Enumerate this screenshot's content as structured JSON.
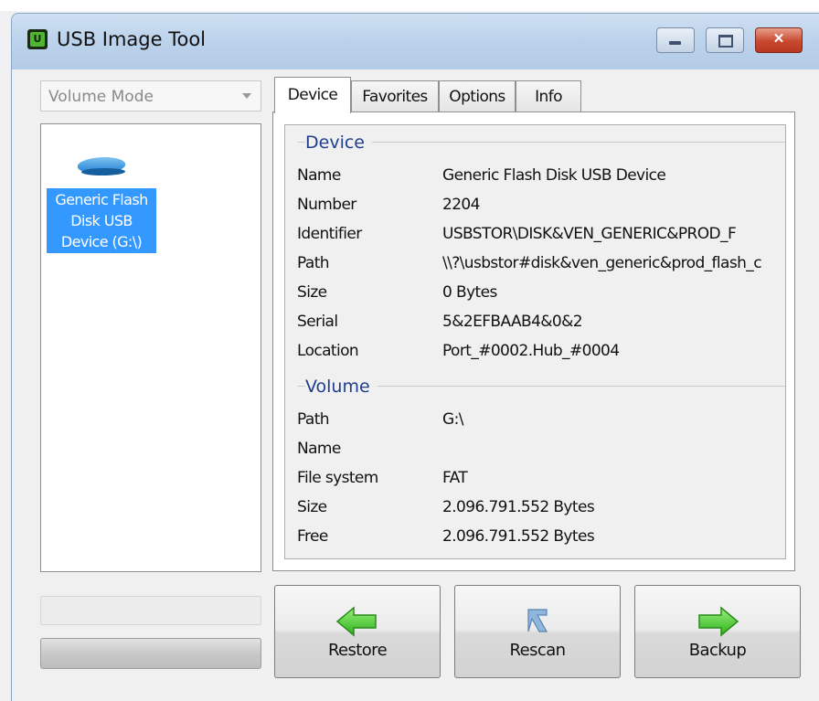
{
  "window": {
    "title": "USB Image Tool",
    "app_icon_letter": "U",
    "close_glyph": "✕"
  },
  "sidebar": {
    "mode_select": "Volume Mode",
    "devices": [
      {
        "label": "Generic Flash Disk USB Device (G:\\)",
        "selected": true,
        "icon": "usb-drive-icon"
      }
    ]
  },
  "tabs": [
    {
      "label": "Device",
      "active": true
    },
    {
      "label": "Favorites",
      "active": false
    },
    {
      "label": "Options",
      "active": false
    },
    {
      "label": "Info",
      "active": false
    }
  ],
  "device_section": {
    "heading": "Device",
    "rows": [
      {
        "label": "Name",
        "value": "Generic Flash Disk USB Device"
      },
      {
        "label": "Number",
        "value": "2204"
      },
      {
        "label": "Identifier",
        "value": "USBSTOR\\DISK&VEN_GENERIC&PROD_F"
      },
      {
        "label": "Path",
        "value": "\\\\?\\usbstor#disk&ven_generic&prod_flash_c"
      },
      {
        "label": "Size",
        "value": "0 Bytes"
      },
      {
        "label": "Serial",
        "value": "5&2EFBAAB4&0&2"
      },
      {
        "label": "Location",
        "value": "Port_#0002.Hub_#0004"
      }
    ]
  },
  "volume_section": {
    "heading": "Volume",
    "rows": [
      {
        "label": "Path",
        "value": "G:\\"
      },
      {
        "label": "Name",
        "value": ""
      },
      {
        "label": "File system",
        "value": "FAT"
      },
      {
        "label": "Size",
        "value": "2.096.791.552 Bytes"
      },
      {
        "label": "Free",
        "value": "2.096.791.552 Bytes"
      }
    ]
  },
  "actions": {
    "restore": "Restore",
    "rescan": "Rescan",
    "backup": "Backup"
  },
  "colors": {
    "selection": "#3399ff",
    "group_heading": "#1f3f8e",
    "arrow_green": "#4ccf3a"
  }
}
